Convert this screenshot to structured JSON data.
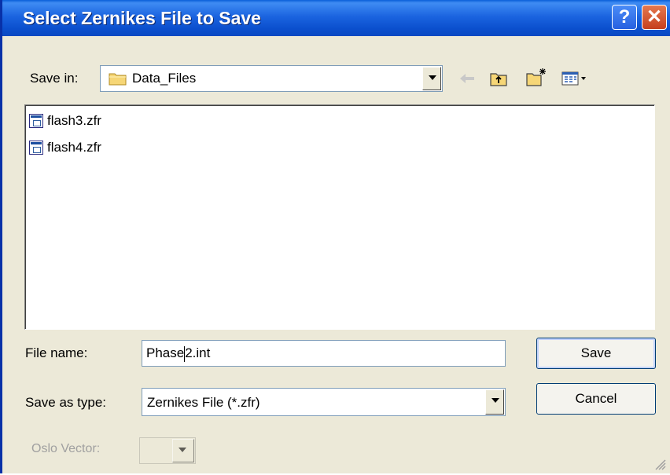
{
  "window": {
    "title": "Select Zernikes File to Save",
    "help_glyph": "?",
    "close_glyph": "✕"
  },
  "toolbar": {
    "save_in_label": "Save in:",
    "save_in_value": "Data_Files",
    "icons": [
      "folder-icon",
      "back-arrow-icon",
      "up-folder-icon",
      "new-folder-icon",
      "view-menu-icon"
    ]
  },
  "files": [
    {
      "name": "flash3.zfr"
    },
    {
      "name": "flash4.zfr"
    }
  ],
  "form": {
    "file_name_label": "File name:",
    "file_name_before_caret": "Phase",
    "file_name_after_caret": "2.int",
    "save_as_type_label": "Save as type:",
    "save_as_type_value": "Zernikes File (*.zfr)",
    "oslo_vector_label": "Oslo Vector:"
  },
  "buttons": {
    "save": "Save",
    "cancel": "Cancel"
  },
  "colors": {
    "titlebar": "#0b4fcd",
    "dialog_bg": "#ece9d8",
    "close_button": "#c5401f"
  }
}
